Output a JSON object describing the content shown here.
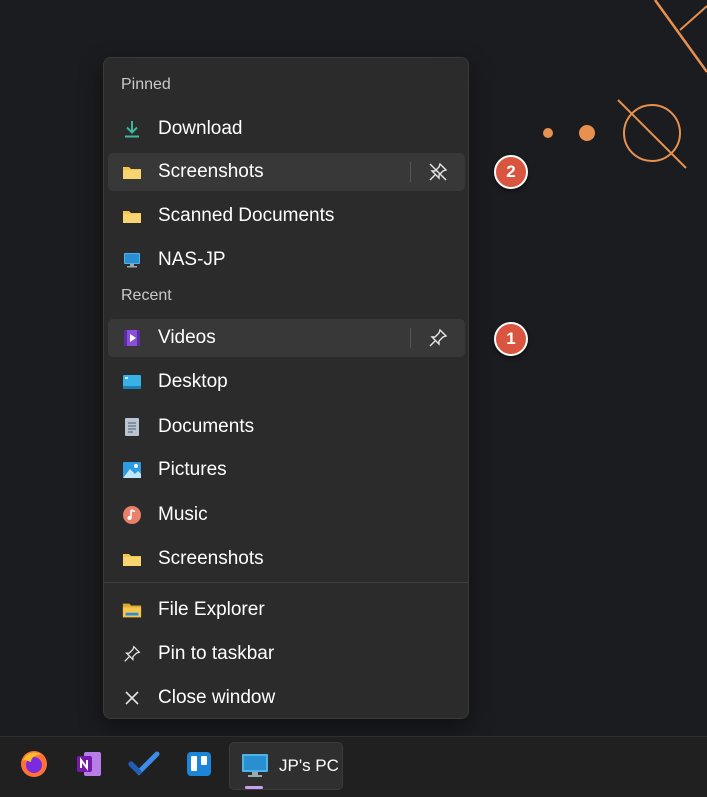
{
  "jumplist": {
    "pinned_header": "Pinned",
    "pinned": [
      {
        "label": "Download",
        "icon": "download-icon"
      },
      {
        "label": "Screenshots",
        "icon": "folder-icon",
        "action_icon": "unpin-icon"
      },
      {
        "label": "Scanned Documents",
        "icon": "folder-icon"
      },
      {
        "label": "NAS-JP",
        "icon": "computer-icon"
      }
    ],
    "recent_header": "Recent",
    "recent": [
      {
        "label": "Videos",
        "icon": "videos-icon",
        "action_icon": "pin-icon"
      },
      {
        "label": "Desktop",
        "icon": "desktop-icon"
      },
      {
        "label": "Documents",
        "icon": "documents-icon"
      },
      {
        "label": "Pictures",
        "icon": "pictures-icon"
      },
      {
        "label": "Music",
        "icon": "music-icon"
      },
      {
        "label": "Screenshots",
        "icon": "folder-icon"
      }
    ],
    "tasks": [
      {
        "label": "File Explorer",
        "icon": "file-explorer-icon"
      },
      {
        "label": "Pin to taskbar",
        "icon": "pin-icon"
      },
      {
        "label": "Close window",
        "icon": "close-icon"
      }
    ]
  },
  "callouts": [
    "2",
    "1"
  ],
  "taskbar": {
    "apps": [
      {
        "name": "Firefox",
        "icon": "firefox-icon"
      },
      {
        "name": "OneNote",
        "icon": "onenote-icon"
      },
      {
        "name": "To Do",
        "icon": "todo-icon"
      },
      {
        "name": "Trello",
        "icon": "trello-icon"
      }
    ],
    "active_label": "JP's PC",
    "active_icon": "monitor-icon"
  },
  "colors": {
    "background": "#1b1c20",
    "menu": "#2b2b2b",
    "hover": "#383838",
    "callout": "#d9553f",
    "decoration": "#e8914f",
    "folder": "#f5c451",
    "download": "#3fb6a0"
  }
}
